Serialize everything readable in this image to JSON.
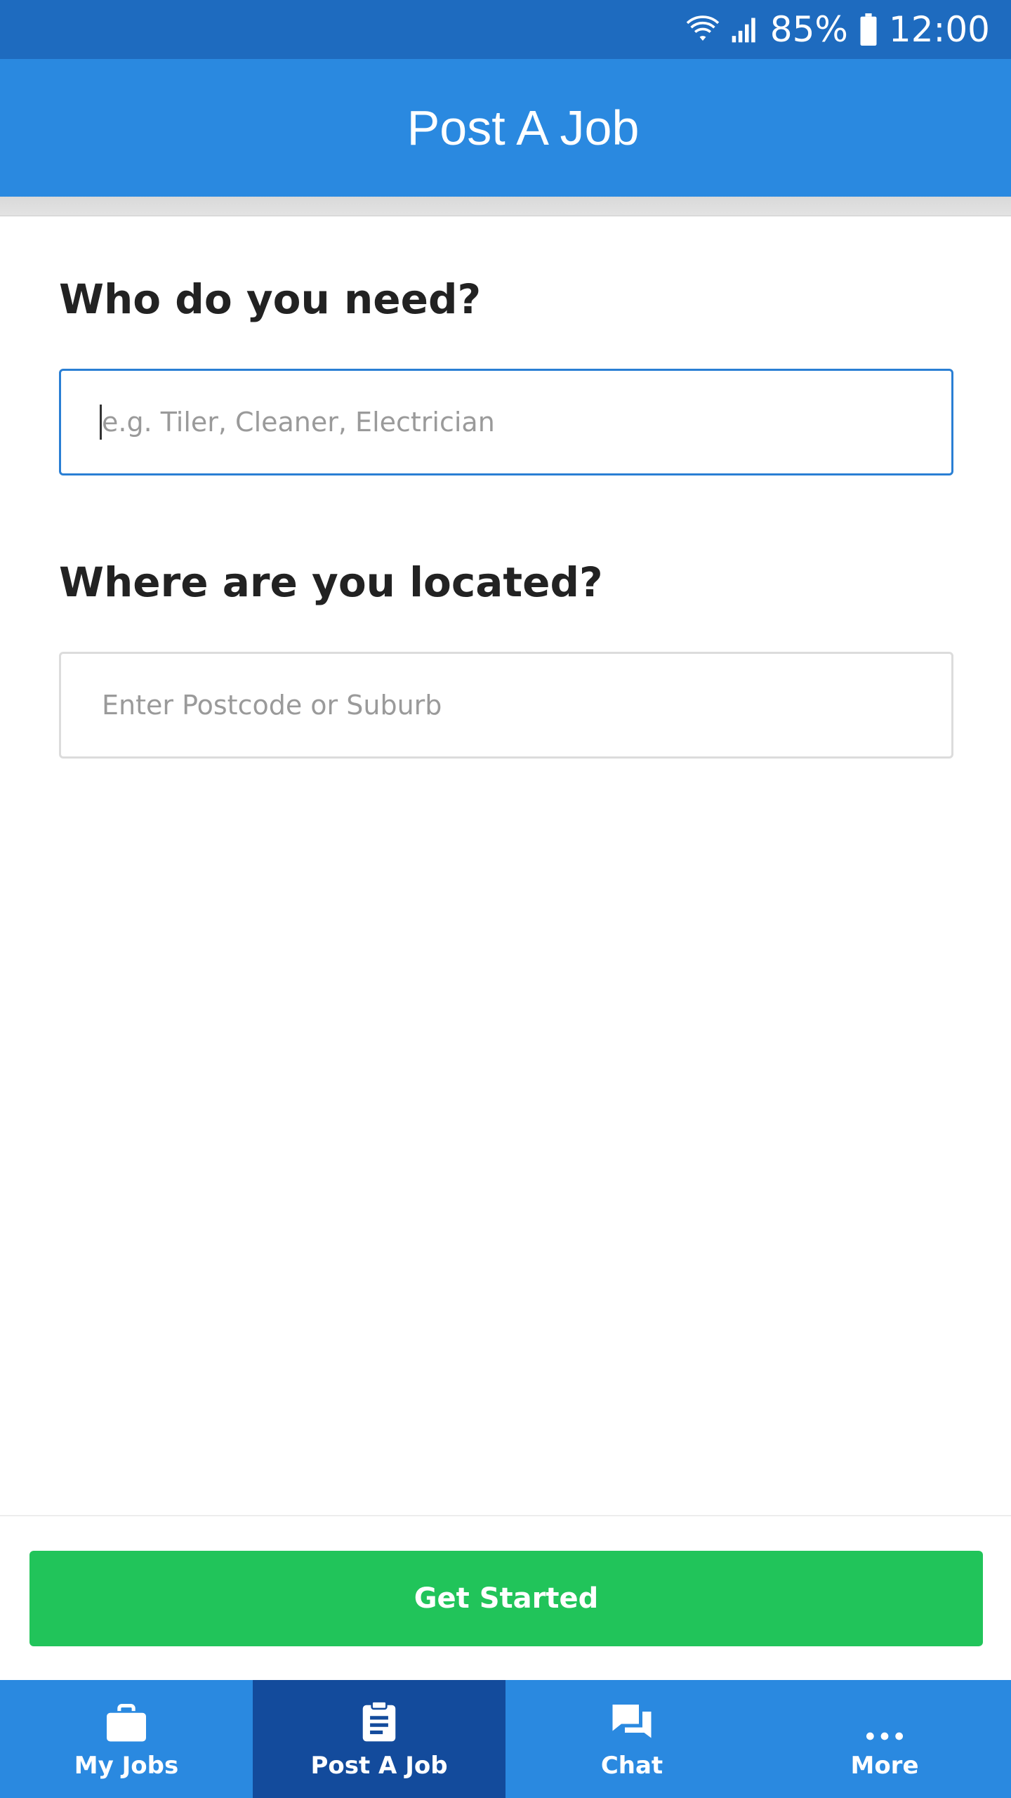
{
  "status_bar": {
    "battery_text": "85%",
    "time": "12:00",
    "icons": [
      "wifi-icon",
      "signal-icon",
      "battery-icon"
    ]
  },
  "app_bar": {
    "title": "Post A Job"
  },
  "form": {
    "who_label": "Who do you need?",
    "who_placeholder": "e.g. Tiler, Cleaner, Electrician",
    "who_value": "",
    "where_label": "Where are you located?",
    "where_placeholder": "Enter Postcode or Suburb",
    "where_value": ""
  },
  "cta": {
    "label": "Get Started"
  },
  "bottom_nav": {
    "items": [
      {
        "label": "My Jobs",
        "icon": "briefcase-icon",
        "active": false
      },
      {
        "label": "Post A Job",
        "icon": "clipboard-icon",
        "active": true
      },
      {
        "label": "Chat",
        "icon": "chat-icon",
        "active": false
      },
      {
        "label": "More",
        "icon": "more-dots-icon",
        "active": false
      }
    ]
  },
  "colors": {
    "status_bar": "#1e6bbf",
    "app_bar": "#2a89e0",
    "nav_active": "#134b9c",
    "cta": "#21c45a",
    "focus_border": "#2a7fd4"
  }
}
